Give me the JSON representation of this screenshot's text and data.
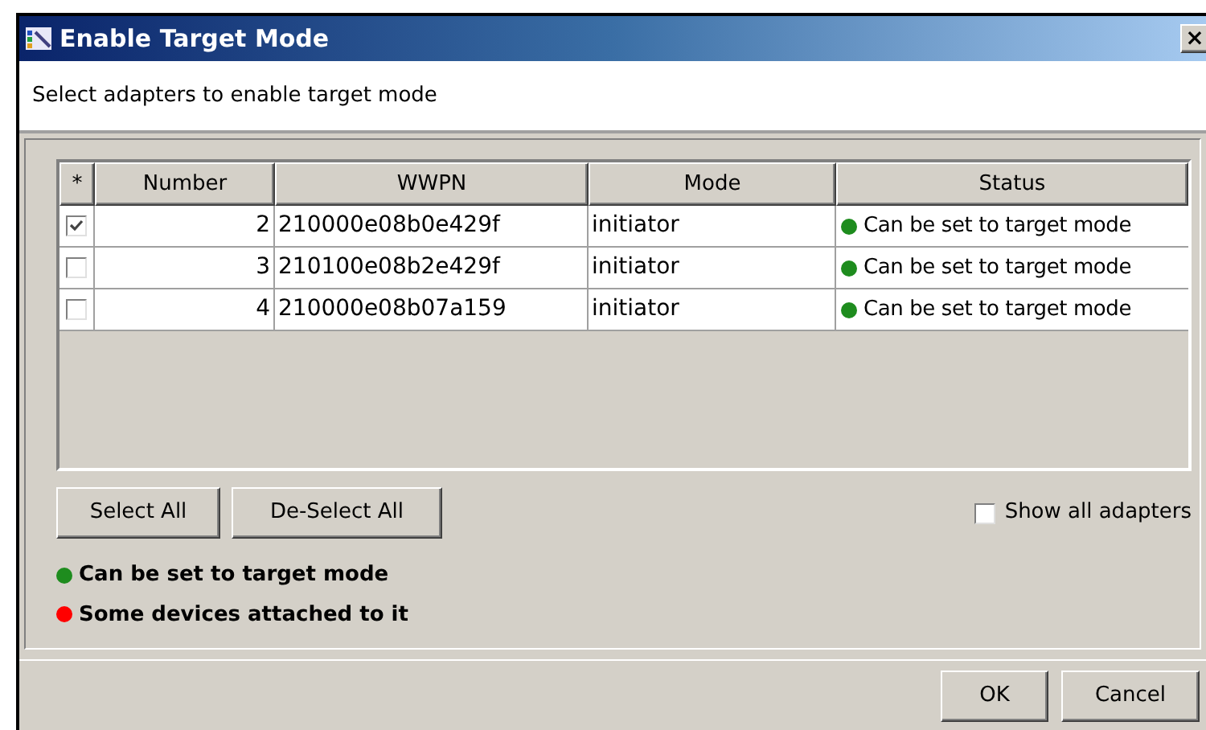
{
  "window": {
    "title": "Enable Target Mode",
    "close": "×"
  },
  "instruction": "Select adapters to enable target mode",
  "table": {
    "columns": [
      "*",
      "Number",
      "WWPN",
      "Mode",
      "Status"
    ],
    "rows": [
      {
        "checked": true,
        "number": "2",
        "wwpn": "210000e08b0e429f",
        "mode": "initiator",
        "status": "Can be set to target mode",
        "color": "#1e8c1e"
      },
      {
        "checked": false,
        "number": "3",
        "wwpn": "210100e08b2e429f",
        "mode": "initiator",
        "status": "Can be set to target mode",
        "color": "#1e8c1e"
      },
      {
        "checked": false,
        "number": "4",
        "wwpn": "210000e08b07a159",
        "mode": "initiator",
        "status": "Can be set to target mode",
        "color": "#1e8c1e"
      }
    ]
  },
  "buttons": [
    "Select All",
    "De-Select All"
  ],
  "show_all": {
    "label": "Show all adapters",
    "checked": false
  },
  "legend": [
    {
      "label": "Can be set to target mode",
      "color": "#1e8c1e"
    },
    {
      "label": "Some devices attached to it",
      "color": "#ff0000"
    }
  ],
  "footer_buttons": [
    "OK",
    "Cancel"
  ]
}
